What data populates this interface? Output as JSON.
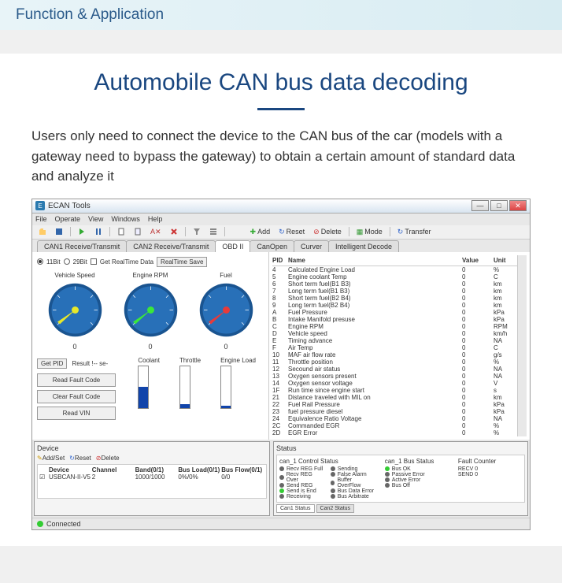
{
  "banner": "Function & Application",
  "title": "Automobile CAN bus data decoding",
  "desc": "Users only need to connect the device to the CAN bus of the car (models with a gateway need to bypass the gateway) to obtain a certain amount of standard data and analyze it",
  "app": {
    "title": "ECAN Tools",
    "menu": [
      "File",
      "Operate",
      "View",
      "Windows",
      "Help"
    ],
    "toolbar2": {
      "add": "Add",
      "reset": "Reset",
      "delete": "Delete",
      "mode": "Mode",
      "transfer": "Transfer"
    },
    "tabs": [
      "CAN1 Receive/Transmit",
      "CAN2 Receive/Transmit",
      "OBD II",
      "CanOpen",
      "Curver",
      "Intelligent Decode"
    ],
    "active_tab": 2,
    "bitrow": {
      "r1": "11Bit",
      "r2": "29Bit",
      "cb": "Get RealTime Data",
      "btn": "RealTime Save"
    },
    "gauges": [
      {
        "label": "Vehicle Speed",
        "value": "0",
        "needle": "#e8e82a"
      },
      {
        "label": "Engine RPM",
        "value": "0",
        "needle": "#3ae83a"
      },
      {
        "label": "Fuel",
        "value": "0",
        "needle": "#e83a3a"
      }
    ],
    "bars": [
      {
        "label": "Coolant",
        "fill": 50,
        "color": "#14a"
      },
      {
        "label": "Throttle",
        "fill": 8,
        "color": "#14a"
      },
      {
        "label": "Engine Load",
        "fill": 4,
        "color": "#14a"
      }
    ],
    "getpid": "Get PID",
    "result": "Result !-- se-",
    "actions": [
      "Read Fault\nCode",
      "Clear Fault\nCode",
      "Read VIN"
    ],
    "pid_head": {
      "c1": "PID",
      "c2": "Name",
      "c3": "Value",
      "c4": "Unit"
    },
    "pids": [
      {
        "p": "4",
        "n": "Calculated Engine Load",
        "v": "0",
        "u": "%"
      },
      {
        "p": "5",
        "n": "Engine coolant Temp",
        "v": "0",
        "u": "C"
      },
      {
        "p": "6",
        "n": "Short term fuel(B1 B3)",
        "v": "0",
        "u": "km"
      },
      {
        "p": "7",
        "n": "Long term fuel(B1 B3)",
        "v": "0",
        "u": "km"
      },
      {
        "p": "8",
        "n": "Short term fuel(B2 B4)",
        "v": "0",
        "u": "km"
      },
      {
        "p": "9",
        "n": "Long term fuel(B2 B4)",
        "v": "0",
        "u": "km"
      },
      {
        "p": "A",
        "n": "Fuel Pressure",
        "v": "0",
        "u": "kPa"
      },
      {
        "p": "B",
        "n": "Intake Manifold presuse",
        "v": "0",
        "u": "kPa"
      },
      {
        "p": "C",
        "n": "Engine RPM",
        "v": "0",
        "u": "RPM"
      },
      {
        "p": "D",
        "n": "Vehicle speed",
        "v": "0",
        "u": "km/h"
      },
      {
        "p": "E",
        "n": "Timing advance",
        "v": "0",
        "u": "NA"
      },
      {
        "p": "F",
        "n": "Air Temp",
        "v": "0",
        "u": "C"
      },
      {
        "p": "10",
        "n": "MAF air flow rate",
        "v": "0",
        "u": "g/s"
      },
      {
        "p": "11",
        "n": "Throttle position",
        "v": "0",
        "u": "%"
      },
      {
        "p": "12",
        "n": "Secound air status",
        "v": "0",
        "u": "NA"
      },
      {
        "p": "13",
        "n": "Oxygen sensors present",
        "v": "0",
        "u": "NA"
      },
      {
        "p": "14",
        "n": "Oxygen sensor voltage",
        "v": "0",
        "u": "V"
      },
      {
        "p": "1F",
        "n": "Run time since engine start",
        "v": "0",
        "u": "s"
      },
      {
        "p": "21",
        "n": "Distance traveled with MIL on",
        "v": "0",
        "u": "km"
      },
      {
        "p": "22",
        "n": "Fuel Rail Pressure",
        "v": "0",
        "u": "kPa"
      },
      {
        "p": "23",
        "n": "fuel pressure diesel",
        "v": "0",
        "u": "kPa"
      },
      {
        "p": "24",
        "n": "Equivalence Ratio Voltage",
        "v": "0",
        "u": "NA"
      },
      {
        "p": "2C",
        "n": "Commanded EGR",
        "v": "0",
        "u": "%"
      },
      {
        "p": "2D",
        "n": "EGR Error",
        "v": "0",
        "u": "%"
      }
    ],
    "device": {
      "title": "Device",
      "tb": {
        "add": "Add/Set",
        "reset": "Reset",
        "delete": "Delete"
      },
      "head": [
        "Device",
        "Channel",
        "Band(0/1)",
        "Bus Load(0/1)",
        "Bus Flow(0/1)"
      ],
      "row": [
        "USBCAN-II-V5",
        "2",
        "1000/1000",
        "0%/0%",
        "0/0"
      ]
    },
    "status": {
      "title": "Status",
      "col1": {
        "h": "can_1 Control Status",
        "items": [
          "Recv REG Full",
          "Recv REG Over",
          "Send REG",
          "Send is End",
          "Receiving",
          "Sending",
          "False Alarm",
          "Buffer OverFlow",
          "Bus Data Error",
          "Bus Arbitrate"
        ]
      },
      "col2": {
        "h": "can_1 Bus Status",
        "items": [
          "Bus OK",
          "Passive Error",
          "Active Error",
          "Bus Off"
        ]
      },
      "col3": {
        "h": "Fault Counter",
        "recv": "RECV  0",
        "send": "SEND  0"
      },
      "tabs": [
        "Can1 Status",
        "Can2 Status"
      ]
    },
    "bottomstatus": "Connected"
  }
}
